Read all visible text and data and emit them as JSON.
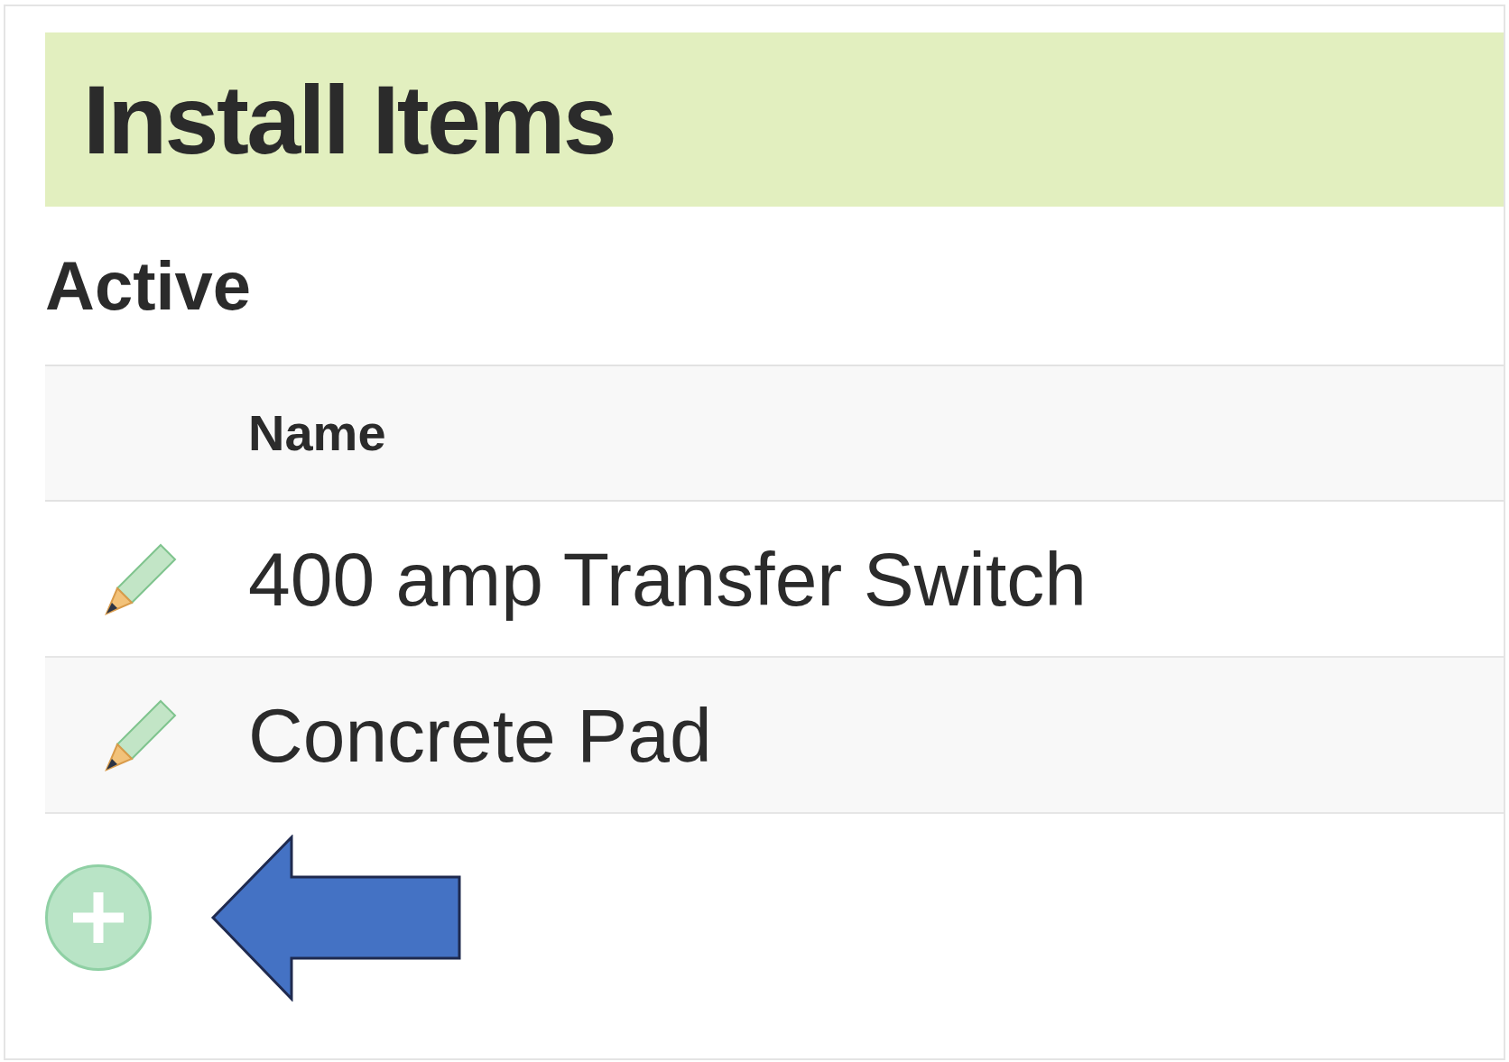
{
  "header": {
    "title": "Install Items"
  },
  "section": {
    "title": "Active"
  },
  "table": {
    "columns": [
      "Name"
    ],
    "rows": [
      {
        "name": "400 amp Transfer Switch"
      },
      {
        "name": "Concrete Pad"
      }
    ]
  }
}
